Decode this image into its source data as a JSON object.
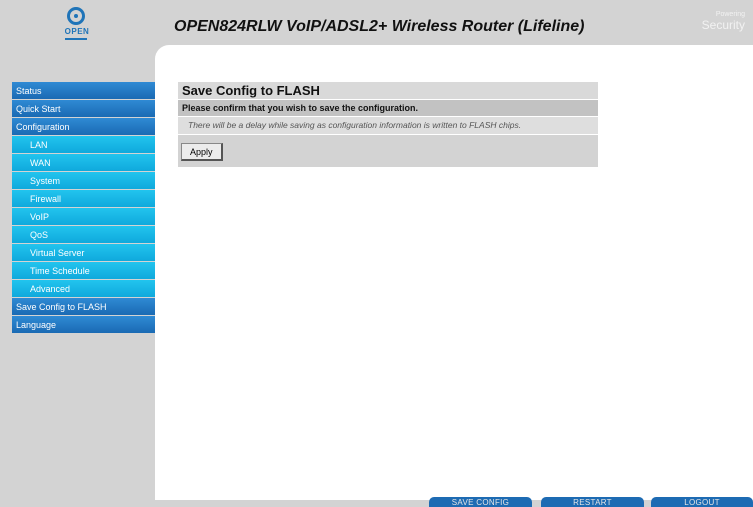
{
  "header": {
    "logo_text": "OPEN",
    "title": "OPEN824RLW VoIP/ADSL2+ Wireless Router (Lifeline)",
    "powering_line1": "Powering",
    "powering_line2": "Security"
  },
  "sidebar": {
    "items": [
      {
        "label": "Status",
        "sub": false
      },
      {
        "label": "Quick Start",
        "sub": false
      },
      {
        "label": "Configuration",
        "sub": false
      },
      {
        "label": "LAN",
        "sub": true
      },
      {
        "label": "WAN",
        "sub": true
      },
      {
        "label": "System",
        "sub": true
      },
      {
        "label": "Firewall",
        "sub": true
      },
      {
        "label": "VoIP",
        "sub": true
      },
      {
        "label": "QoS",
        "sub": true
      },
      {
        "label": "Virtual Server",
        "sub": true
      },
      {
        "label": "Time Schedule",
        "sub": true
      },
      {
        "label": "Advanced",
        "sub": true
      },
      {
        "label": "Save Config to FLASH",
        "sub": false
      },
      {
        "label": "Language",
        "sub": false
      }
    ]
  },
  "content": {
    "title": "Save Config to FLASH",
    "confirm": "Please confirm that you wish to save the configuration.",
    "note": "There will be a delay while saving as configuration information is written to FLASH chips.",
    "apply_label": "Apply"
  },
  "footer": {
    "save_config": "SAVE CONFIG",
    "restart": "RESTART",
    "logout": "LOGOUT"
  },
  "colors": {
    "background": "#d3d3d3",
    "nav_main": "#1a6ab3",
    "nav_sub": "#0fa9dc",
    "footer_button": "#1d6bb3"
  }
}
